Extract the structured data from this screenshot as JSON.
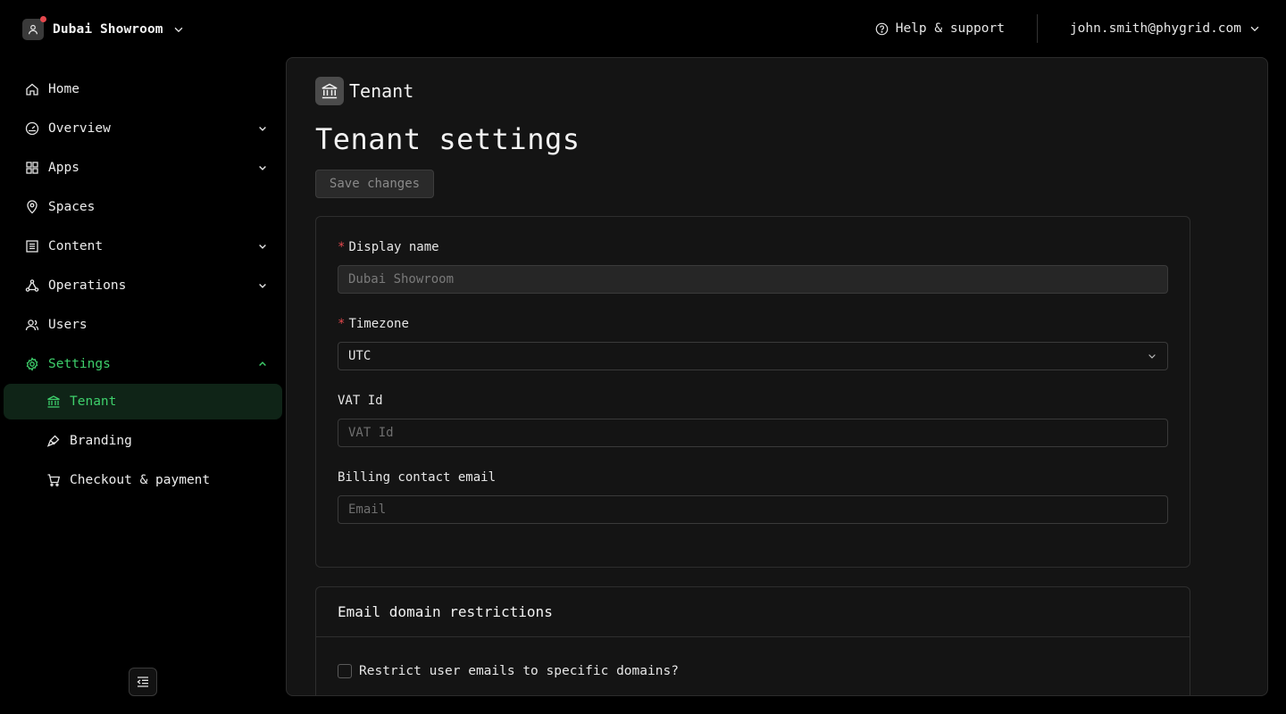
{
  "org": {
    "name": "Dubai Showroom"
  },
  "topbar": {
    "help_label": "Help & support",
    "user_email": "john.smith@phygrid.com"
  },
  "sidebar": {
    "items": [
      {
        "label": "Home"
      },
      {
        "label": "Overview"
      },
      {
        "label": "Apps"
      },
      {
        "label": "Spaces"
      },
      {
        "label": "Content"
      },
      {
        "label": "Operations"
      },
      {
        "label": "Users"
      },
      {
        "label": "Settings"
      }
    ],
    "settings_sub": [
      {
        "label": "Tenant"
      },
      {
        "label": "Branding"
      },
      {
        "label": "Checkout & payment"
      }
    ]
  },
  "page": {
    "breadcrumb_title": "Tenant",
    "title": "Tenant settings",
    "save_label": "Save changes"
  },
  "form": {
    "display_name": {
      "label": "Display name",
      "value": "Dubai Showroom"
    },
    "timezone": {
      "label": "Timezone",
      "value": "UTC"
    },
    "vat": {
      "label": "VAT Id",
      "placeholder": "VAT Id"
    },
    "billing": {
      "label": "Billing contact email",
      "placeholder": "Email"
    }
  },
  "restrictions": {
    "title": "Email domain restrictions",
    "checkbox_label": "Restrict user emails to specific domains?"
  },
  "colors": {
    "accent": "#3ecf6b",
    "required": "#e5484d",
    "notification_dot": "#e5484d"
  }
}
